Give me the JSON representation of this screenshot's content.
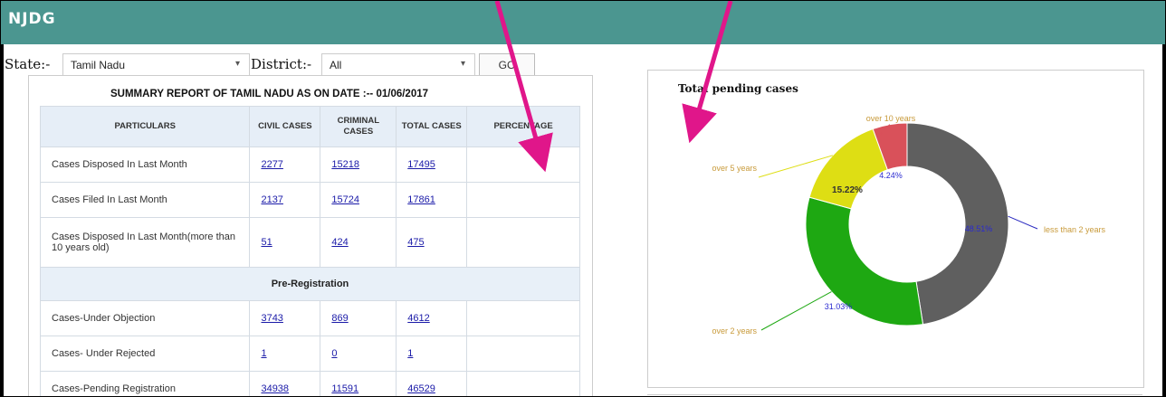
{
  "header": {
    "brand": "NJDG"
  },
  "filters": {
    "state_label": "State:-",
    "state_value": "Tamil Nadu",
    "district_label": "District:-",
    "district_value": "All",
    "go_label": "GO"
  },
  "report": {
    "title": "SUMMARY REPORT OF TAMIL NADU AS ON DATE :-- 01/06/2017",
    "columns": [
      "PARTICULARS",
      "CIVIL CASES",
      "CRIMINAL CASES",
      "TOTAL CASES",
      "PERCENTAGE"
    ],
    "rows": [
      {
        "label": "Cases Disposed In Last Month",
        "civil": "2277",
        "criminal": "15218",
        "total": "17495"
      },
      {
        "label": "Cases Filed In Last Month",
        "civil": "2137",
        "criminal": "15724",
        "total": "17861"
      },
      {
        "label": "Cases Disposed In Last Month(more than 10 years old)",
        "civil": "51",
        "criminal": "424",
        "total": "475"
      }
    ],
    "section": "Pre-Registration",
    "pre_rows": [
      {
        "label": "Cases-Under Objection",
        "civil": "3743",
        "criminal": "869",
        "total": "4612"
      },
      {
        "label": "Cases- Under Rejected",
        "civil": "1",
        "criminal": "0",
        "total": "1"
      },
      {
        "label": "Cases-Pending Registration",
        "civil": "34938",
        "criminal": "11591",
        "total": "46529"
      }
    ]
  },
  "chart_data": {
    "type": "pie",
    "title": "Total pending cases",
    "donut": true,
    "categories": [
      "less than 2 years",
      "over 2 years",
      "over 5 years",
      "over 10 years"
    ],
    "values": [
      47.5,
      31.8,
      15.22,
      5.48
    ],
    "data_labels": [
      "48.51%",
      "31.03%",
      "15.22%",
      "4.24%"
    ],
    "colors": [
      "#5f5f5f",
      "#1ea812",
      "#dede14",
      "#d9515a"
    ],
    "legend": "callout labels"
  },
  "annotations": {
    "arrow_color": "#e0168a"
  }
}
